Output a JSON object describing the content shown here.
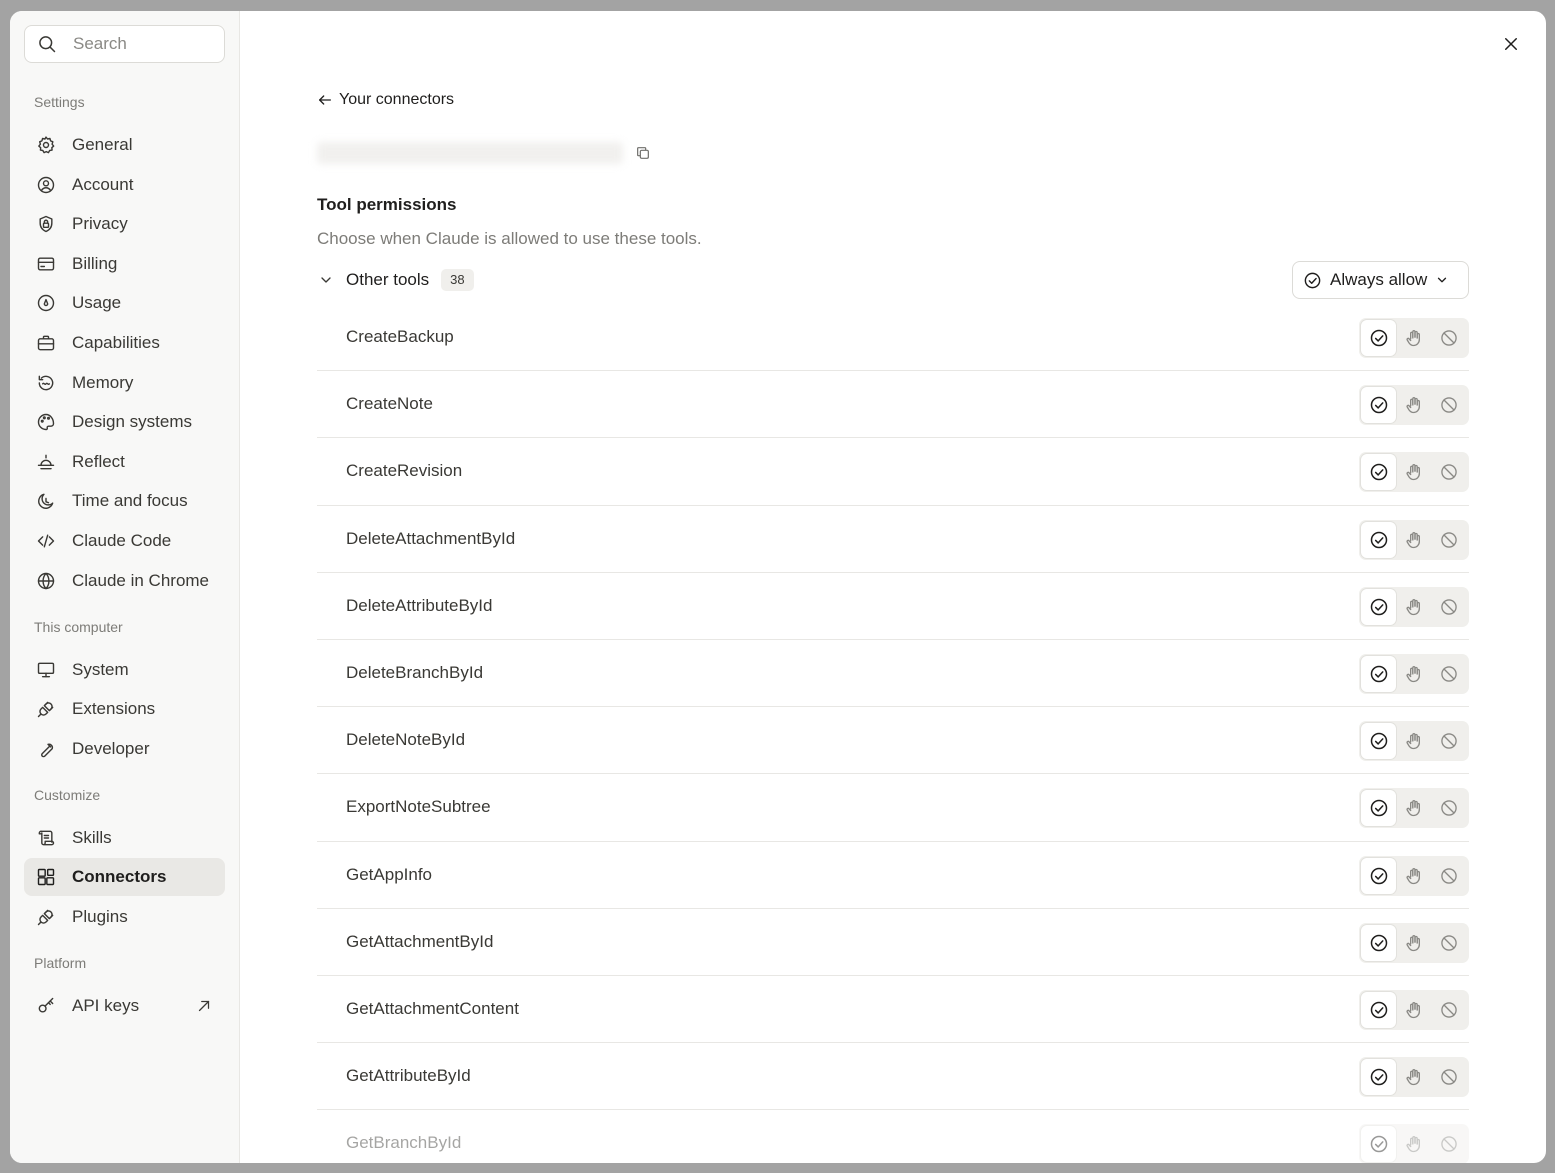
{
  "sidebar": {
    "search_placeholder": "Search",
    "sections": [
      {
        "label": "Settings",
        "items": [
          {
            "label": "General",
            "icon": "gear-icon"
          },
          {
            "label": "Account",
            "icon": "user-circle-icon"
          },
          {
            "label": "Privacy",
            "icon": "shield-lock-icon"
          },
          {
            "label": "Billing",
            "icon": "credit-card-icon"
          },
          {
            "label": "Usage",
            "icon": "gauge-icon"
          },
          {
            "label": "Capabilities",
            "icon": "briefcase-icon"
          },
          {
            "label": "Memory",
            "icon": "memory-icon"
          },
          {
            "label": "Design systems",
            "icon": "palette-icon"
          },
          {
            "label": "Reflect",
            "icon": "sunrise-icon"
          },
          {
            "label": "Time and focus",
            "icon": "moon-clock-icon"
          },
          {
            "label": "Claude Code",
            "icon": "code-icon"
          },
          {
            "label": "Claude in Chrome",
            "icon": "globe-icon"
          }
        ]
      },
      {
        "label": "This computer",
        "items": [
          {
            "label": "System",
            "icon": "monitor-icon"
          },
          {
            "label": "Extensions",
            "icon": "plug-icon"
          },
          {
            "label": "Developer",
            "icon": "wrench-icon"
          }
        ]
      },
      {
        "label": "Customize",
        "items": [
          {
            "label": "Skills",
            "icon": "scroll-icon"
          },
          {
            "label": "Connectors",
            "icon": "connectors-icon",
            "active": true
          },
          {
            "label": "Plugins",
            "icon": "plug-icon"
          }
        ]
      },
      {
        "label": "Platform",
        "items": [
          {
            "label": "API keys",
            "icon": "key-icon",
            "external": true
          }
        ]
      }
    ]
  },
  "main": {
    "back_label": "Your connectors",
    "title": "Tool permissions",
    "description": "Choose when Claude is allowed to use these tools.",
    "group": {
      "title": "Other tools",
      "count": "38",
      "selected_permission": "Always allow"
    },
    "tools": [
      {
        "name": "CreateBackup"
      },
      {
        "name": "CreateNote"
      },
      {
        "name": "CreateRevision"
      },
      {
        "name": "DeleteAttachmentById"
      },
      {
        "name": "DeleteAttributeById"
      },
      {
        "name": "DeleteBranchById"
      },
      {
        "name": "DeleteNoteById"
      },
      {
        "name": "ExportNoteSubtree"
      },
      {
        "name": "GetAppInfo"
      },
      {
        "name": "GetAttachmentById"
      },
      {
        "name": "GetAttachmentContent"
      },
      {
        "name": "GetAttributeById"
      },
      {
        "name": "GetBranchById",
        "faded": true
      }
    ]
  }
}
